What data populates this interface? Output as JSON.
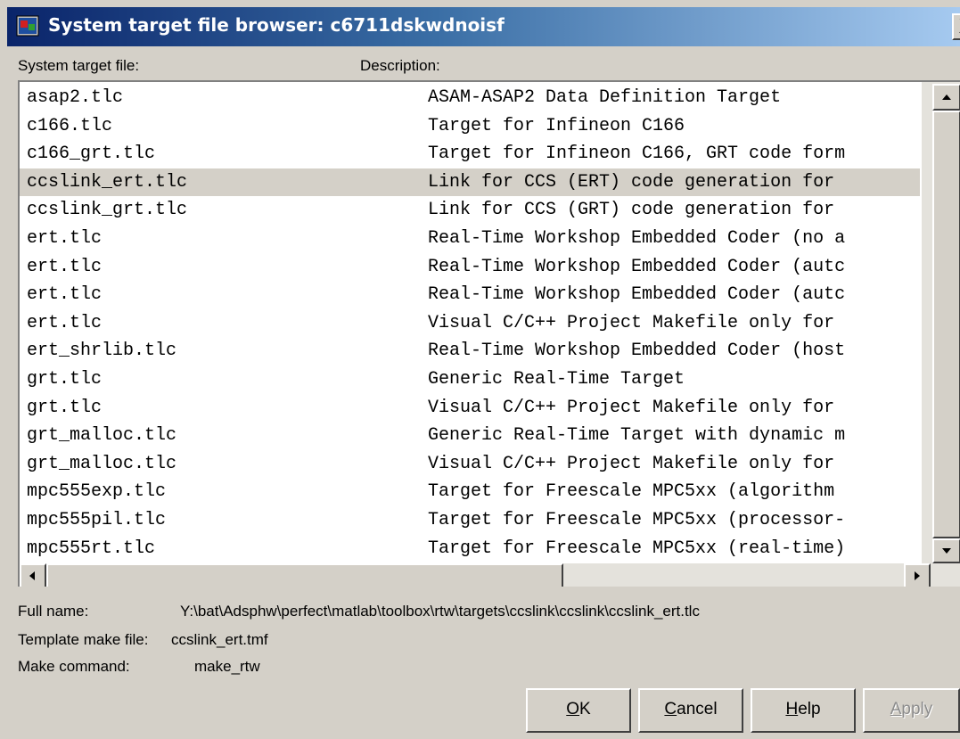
{
  "window": {
    "title": "System target file browser: c6711dskwdnoisf",
    "close_glyph": "X"
  },
  "columns": {
    "file_header": "System target file:",
    "description_header": "Description:"
  },
  "rows": [
    {
      "file": "asap2.tlc",
      "description": "ASAM-ASAP2 Data Definition Target",
      "selected": false
    },
    {
      "file": "c166.tlc",
      "description": "Target for Infineon C166",
      "selected": false
    },
    {
      "file": "c166_grt.tlc",
      "description": "Target for Infineon C166, GRT code form",
      "selected": false
    },
    {
      "file": "ccslink_ert.tlc",
      "description": "Link for CCS (ERT) code generation for",
      "selected": true
    },
    {
      "file": "ccslink_grt.tlc",
      "description": "Link for CCS (GRT) code generation for",
      "selected": false
    },
    {
      "file": "ert.tlc",
      "description": "Real-Time Workshop Embedded Coder (no a",
      "selected": false
    },
    {
      "file": "ert.tlc",
      "description": "Real-Time Workshop Embedded Coder (autc",
      "selected": false
    },
    {
      "file": "ert.tlc",
      "description": "Real-Time Workshop Embedded Coder (autc",
      "selected": false
    },
    {
      "file": "ert.tlc",
      "description": "Visual C/C++ Project Makefile only for",
      "selected": false
    },
    {
      "file": "ert_shrlib.tlc",
      "description": "Real-Time Workshop Embedded Coder (host",
      "selected": false
    },
    {
      "file": "grt.tlc",
      "description": "Generic Real-Time Target",
      "selected": false
    },
    {
      "file": "grt.tlc",
      "description": "Visual C/C++ Project Makefile only for",
      "selected": false
    },
    {
      "file": "grt_malloc.tlc",
      "description": "Generic Real-Time Target with dynamic m",
      "selected": false
    },
    {
      "file": "grt_malloc.tlc",
      "description": "Visual C/C++ Project Makefile only for",
      "selected": false
    },
    {
      "file": "mpc555exp.tlc",
      "description": "Target for Freescale MPC5xx (algorithm",
      "selected": false
    },
    {
      "file": "mpc555pil.tlc",
      "description": "Target for Freescale MPC5xx (processor-",
      "selected": false
    },
    {
      "file": "mpc555rt.tlc",
      "description": "Target for Freescale MPC5xx (real-time)",
      "selected": false
    }
  ],
  "info": {
    "full_name_label": "Full name:",
    "full_name_value": "Y:\\bat\\Adsphw\\perfect\\matlab\\toolbox\\rtw\\targets\\ccslink\\ccslink\\ccslink_ert.tlc",
    "template_label": "Template make file:",
    "template_value": "ccslink_ert.tmf",
    "make_label": "Make command:",
    "make_value": "make_rtw"
  },
  "buttons": {
    "ok": {
      "mnemonic": "O",
      "rest": "K"
    },
    "cancel": {
      "mnemonic": "C",
      "rest": "ancel"
    },
    "help": {
      "mnemonic": "H",
      "rest": "elp"
    },
    "apply": {
      "mnemonic": "A",
      "rest": "pply",
      "disabled": true
    }
  },
  "colors": {
    "title_gradient_start": "#0a246a",
    "title_gradient_end": "#a6caf0",
    "dialog_face": "#d4d0c8",
    "selection": "#d4d0c8"
  }
}
